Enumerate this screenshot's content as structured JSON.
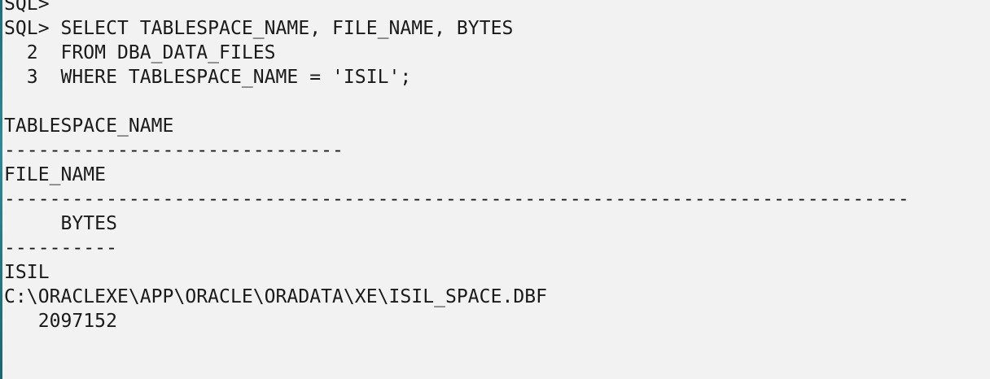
{
  "console": {
    "lines": [
      "SQL>",
      "SQL> SELECT TABLESPACE_NAME, FILE_NAME, BYTES",
      "  2  FROM DBA_DATA_FILES",
      "  3  WHERE TABLESPACE_NAME = 'ISIL';",
      "",
      "TABLESPACE_NAME",
      "------------------------------",
      "FILE_NAME",
      "--------------------------------------------------------------------------------",
      "     BYTES",
      "----------",
      "ISIL",
      "C:\\ORACLEXE\\APP\\ORACLE\\ORADATA\\XE\\ISIL_SPACE.DBF",
      "   2097152"
    ]
  }
}
